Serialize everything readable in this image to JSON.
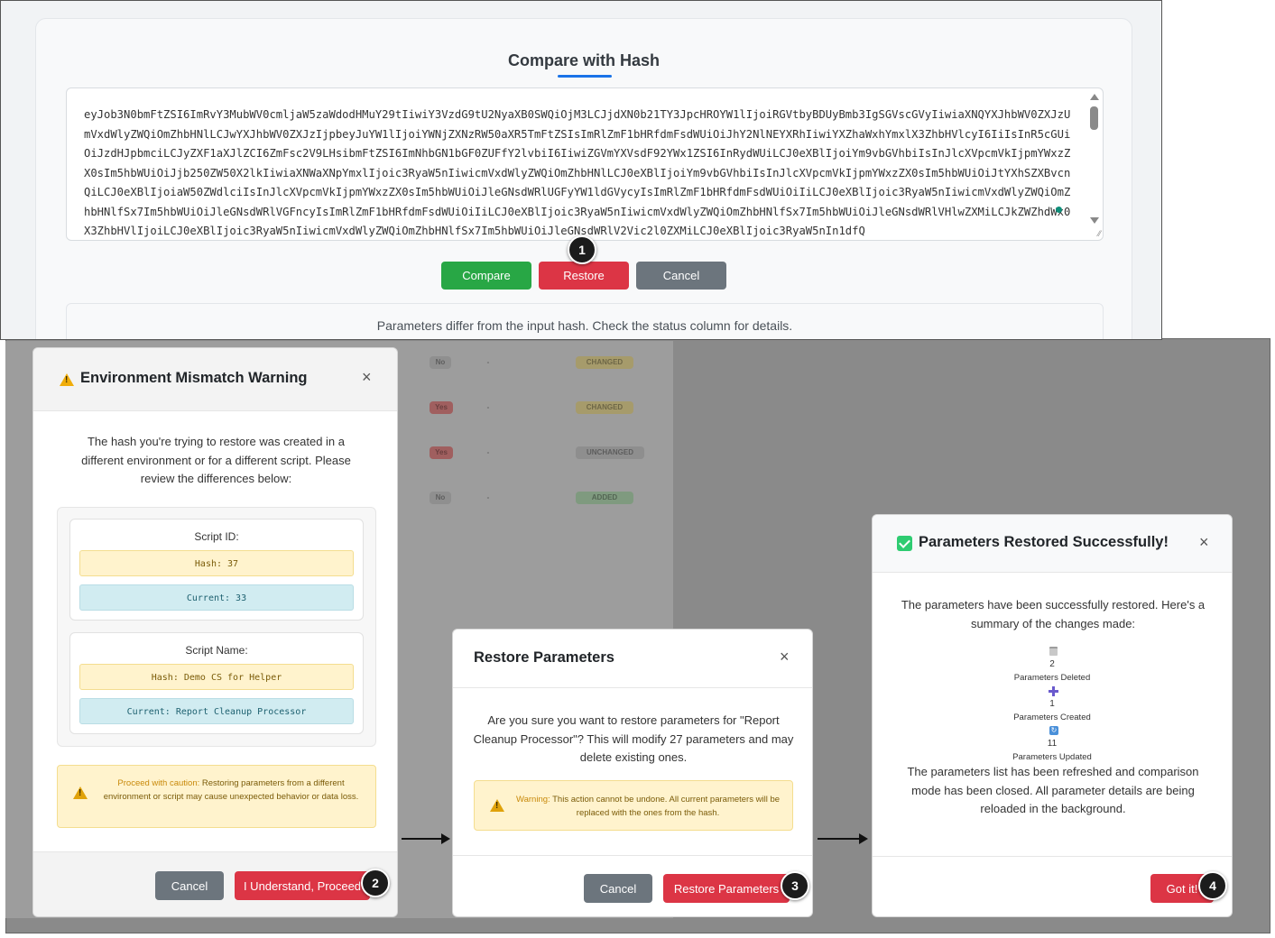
{
  "compare_panel": {
    "title": "Compare with Hash",
    "hash_value": "eyJob3N0bmFtZSI6ImRvY3MubWV0cmljaW5zaWdodHMuY29tIiwiY3VzdG9tU2NyaXB0SWQiOjM3LCJjdXN0b21TY3JpcHROYW1lIjoiRGVtbyBDUyBmb3IgSGVscGVyIiwiaXNQYXJhbWV0ZXJzUmVxdWlyZWQiOmZhbHNlLCJwYXJhbWV0ZXJzIjpbeyJuYW1lIjoiYWNjZXNzRW50aXR5TmFtZSIsImRlZmF1bHRfdmFsdWUiOiJhY2NlNEYXRhIiwiYXZhaWxhYmxlX3ZhbHVlcyI6IiIsInR5cGUiOiJzdHJpbmciLCJyZXF1aXJlZCI6ZmFsc2V9LHsibmFtZSI6ImNhbGN1bGF0ZUFfY2lvbiI6IiwiZGVmYXVsdF92YWx1ZSI6InRydWUiLCJ0eXBlIjoiYm9vbGVhbiIsInJlcXVpcmVkIjpmYWxzZX0sIm5hbWUiOiJjb250ZW50X2lkIiwiaXNWaXNpYmxlIjoic3RyaW5nIiwicmVxdWlyZWQiOmZhbHNlLCJ0eXBlIjoiYm9vbGVhbiIsInJlcXVpcmVkIjpmYWxzZX0sIm5hbWUiOiJtYXhSZXBvcnQiLCJ0eXBlIjoiaW50ZWdlciIsInJlcXVpcmVkIjpmYWxzZX0sIm5hbWUiOiJleGNsdWRlUGFyYW1ldGVycyIsImRlZmF1bHRfdmFsdWUiOiIiLCJ0eXBlIjoic3RyaW5nIiwicmVxdWlyZWQiOmZhbHNlfSx7Im5hbWUiOiJleGNsdWRlVGFncyIsImRlZmF1bHRfdmFsdWUiOiIiLCJ0eXBlIjoic3RyaW5nIiwicmVxdWlyZWQiOmZhbHNlfSx7Im5hbWUiOiJleGNsdWRlVHlwZXMiLCJkZWZhdWx0X3ZhbHVlIjoiLCJ0eXBlIjoic3RyaW5nIiwicmVxdWlyZWQiOmZhbHNlfSx7Im5hbWUiOiJleGNsdWRlV2Vic2l0ZXMiLCJ0eXBlIjoic3RyaW5nIn1dfQ",
    "buttons": {
      "compare": "Compare",
      "restore": "Restore",
      "cancel": "Cancel"
    },
    "status_message": "Parameters differ from the input hash. Check the status column for details."
  },
  "background_badges": {
    "changed": "CHANGED",
    "unchanged": "UNCHANGED",
    "added": "ADDED",
    "no": "No",
    "yes": "Yes",
    "dash": "-"
  },
  "mismatch_modal": {
    "title": "Environment Mismatch Warning",
    "close": "×",
    "message": "The hash you're trying to restore was created in a different environment or for a different script. Please review the differences below:",
    "script_id": {
      "label": "Script ID:",
      "hash": "Hash: 37",
      "current": "Current: 33"
    },
    "script_name": {
      "label": "Script Name:",
      "hash": "Hash: Demo CS for Helper",
      "current": "Current: Report Cleanup Processor"
    },
    "warning_strong": "Proceed with caution:",
    "warning_text": " Restoring parameters from a different environment or script may cause unexpected behavior or data loss.",
    "cancel": "Cancel",
    "proceed": "I Understand, Proceed"
  },
  "restore_modal": {
    "title": "Restore Parameters",
    "close": "×",
    "message": "Are you sure you want to restore parameters for \"Report Cleanup Processor\"? This will modify 27 parameters and may delete existing ones.",
    "warning_strong": "Warning:",
    "warning_text": " This action cannot be undone. All current parameters will be replaced with the ones from the hash.",
    "cancel": "Cancel",
    "confirm": "Restore Parameters"
  },
  "success_modal": {
    "title": "Parameters Restored Successfully!",
    "close": "×",
    "message": "The parameters have been successfully restored. Here's a summary of the changes made:",
    "deleted_count": "2",
    "deleted_label": "Parameters Deleted",
    "created_count": "1",
    "created_label": "Parameters Created",
    "updated_count": "11",
    "updated_label": "Parameters Updated",
    "footer_message": "The parameters list has been refreshed and comparison mode has been closed. All parameter details are being reloaded in the background.",
    "ok": "Got it!"
  },
  "steps": [
    "1",
    "2",
    "3",
    "4"
  ],
  "icons": {
    "warning": "warning-triangle-icon",
    "success": "check-box-icon",
    "deleted": "trash-icon",
    "created": "plus-icon",
    "updated": "refresh-icon"
  },
  "colors": {
    "primary_blue": "#1a73e8",
    "success_green": "#28a745",
    "danger_red": "#dc3545",
    "secondary_gray": "#6c757d",
    "warning_bg": "#fff3cd",
    "info_bg": "#d1ecf1"
  }
}
